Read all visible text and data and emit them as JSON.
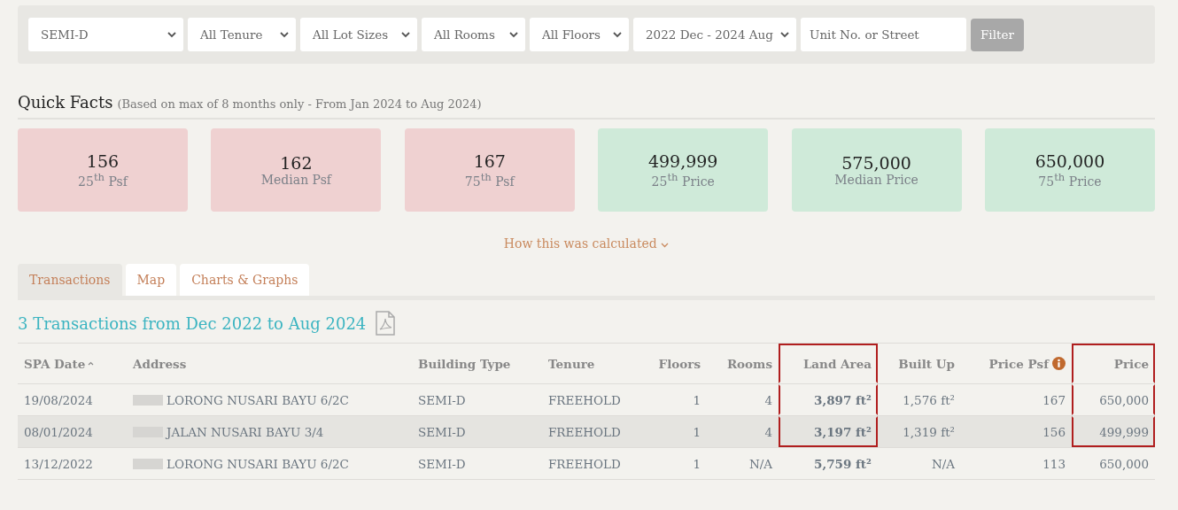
{
  "filters": [
    {
      "kind": "dropdown",
      "value": "SEMI-D"
    },
    {
      "kind": "dropdown",
      "value": "All Tenure"
    },
    {
      "kind": "dropdown",
      "value": "All Lot Sizes"
    },
    {
      "kind": "dropdown",
      "value": "All Rooms"
    },
    {
      "kind": "dropdown",
      "value": "All Floors"
    },
    {
      "kind": "dropdown",
      "value": "2022 Dec - 2024 Aug"
    },
    {
      "kind": "search",
      "placeholder": "Unit No. or Street"
    }
  ],
  "filter_button": {
    "label": "Filter",
    "disabled": true
  },
  "quick_facts": {
    "title": "Quick Facts",
    "note": "(Based on max of 8 months only - From Jan 2024 to Aug 2024)",
    "cards": [
      {
        "value": "156",
        "label": "25$^{th}$ Psf",
        "kind": "psf"
      },
      {
        "value": "162",
        "label": "Median Psf",
        "kind": "psf"
      },
      {
        "value": "167",
        "label": "75$^{th}$ Psf",
        "kind": "psf"
      },
      {
        "value": "499,999",
        "label": "25$^{th}$ Price",
        "kind": "price"
      },
      {
        "value": "575,000",
        "label": "Median Price",
        "kind": "price"
      },
      {
        "value": "650,000",
        "label": "75$^{th}$ Price",
        "kind": "price"
      }
    ],
    "calc_link": "How this was calculated"
  },
  "tabs": [
    {
      "label": "Transactions",
      "selected": true
    },
    {
      "label": "Map",
      "selected": false
    },
    {
      "label": "Charts & Graphs",
      "selected": false
    }
  ],
  "transactions": {
    "heading": "3 Transactions from Dec 2022 to Aug 2024",
    "columns": [
      {
        "label": "SPA Date",
        "numeric": false,
        "sorted": true,
        "highlighted": false
      },
      {
        "label": "Address",
        "numeric": false,
        "sorted": false,
        "highlighted": false
      },
      {
        "label": "Building Type",
        "numeric": false,
        "sorted": false,
        "highlighted": false
      },
      {
        "label": "Tenure",
        "numeric": false,
        "sorted": false,
        "highlighted": false
      },
      {
        "label": "Floors",
        "numeric": true,
        "sorted": false,
        "highlighted": false
      },
      {
        "label": "Rooms",
        "numeric": true,
        "sorted": false,
        "highlighted": false
      },
      {
        "label": "Land Area",
        "numeric": true,
        "sorted": false,
        "highlighted": true,
        "bold": true
      },
      {
        "label": "Built Up",
        "numeric": true,
        "sorted": false,
        "highlighted": false
      },
      {
        "label": "Price Psf",
        "numeric": true,
        "sorted": false,
        "highlighted": false,
        "info": true
      },
      {
        "label": "Price",
        "numeric": true,
        "sorted": false,
        "highlighted": true
      }
    ],
    "rows": [
      {
        "highlighted": true,
        "shaded": false,
        "cells": [
          "19/08/2024",
          "LORONG NUSARI BAYU 6/2C",
          "SEMI-D",
          "FREEHOLD",
          "1",
          "4",
          "3,897 ft²",
          "1,576 ft²",
          "167",
          "650,000"
        ]
      },
      {
        "highlighted": true,
        "shaded": true,
        "cells": [
          "08/01/2024",
          "JALAN NUSARI BAYU 3/4",
          "SEMI-D",
          "FREEHOLD",
          "1",
          "4",
          "3,197 ft²",
          "1,319 ft²",
          "156",
          "499,999"
        ]
      },
      {
        "highlighted": false,
        "shaded": false,
        "cells": [
          "13/12/2022",
          "LORONG NUSARI BAYU 6/2C",
          "SEMI-D",
          "FREEHOLD",
          "1",
          "N/A",
          "5,759 ft²",
          "N/A",
          "113",
          "650,000"
        ]
      }
    ]
  }
}
